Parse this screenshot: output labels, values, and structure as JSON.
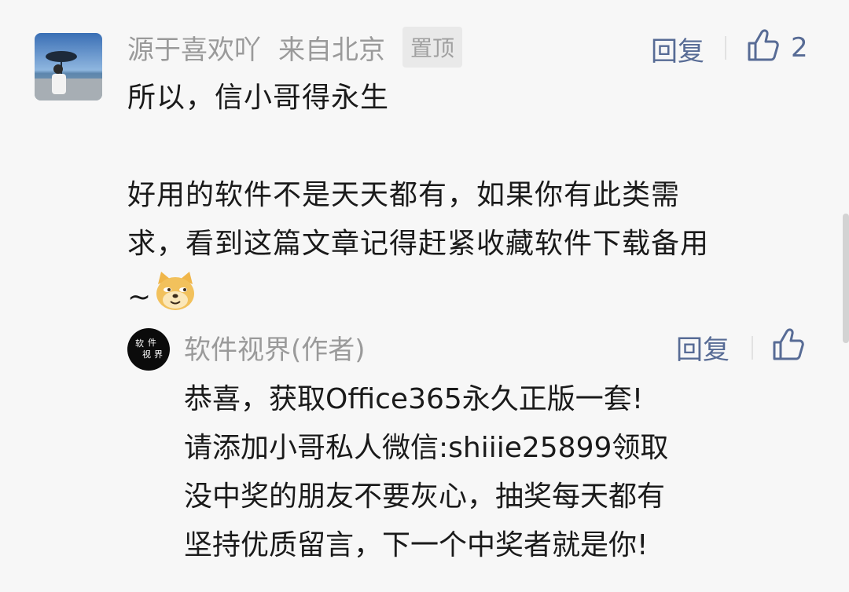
{
  "comment": {
    "username": "源于喜欢吖",
    "location": "来自北京",
    "pinned_label": "置顶",
    "reply_label": "回复",
    "like_count": "2",
    "lines": [
      "所以，信小哥得永生",
      "",
      "好用的软件不是天天都有，如果你有此类需",
      "求，看到这篇文章记得赶紧收藏软件下载备用",
      "~"
    ]
  },
  "author_reply": {
    "name": "软件视界(作者)",
    "reply_label": "回复",
    "avatar_text": [
      "软",
      "件",
      "视",
      "界"
    ],
    "lines": [
      "恭喜，获取Office365永久正版一套!",
      "请添加小哥私人微信:shiiie25899领取",
      "没中奖的朋友不要灰心，抽奖每天都有",
      "坚持优质留言，下一个中奖者就是你!"
    ]
  },
  "colors": {
    "background": "#f7f7f7",
    "link": "#576b95",
    "meta_text": "#9a9a9a",
    "body_text": "#1a1a1a"
  },
  "icons": {
    "like": "thumbs-up-icon",
    "emoji": "doge-emoji-icon"
  }
}
